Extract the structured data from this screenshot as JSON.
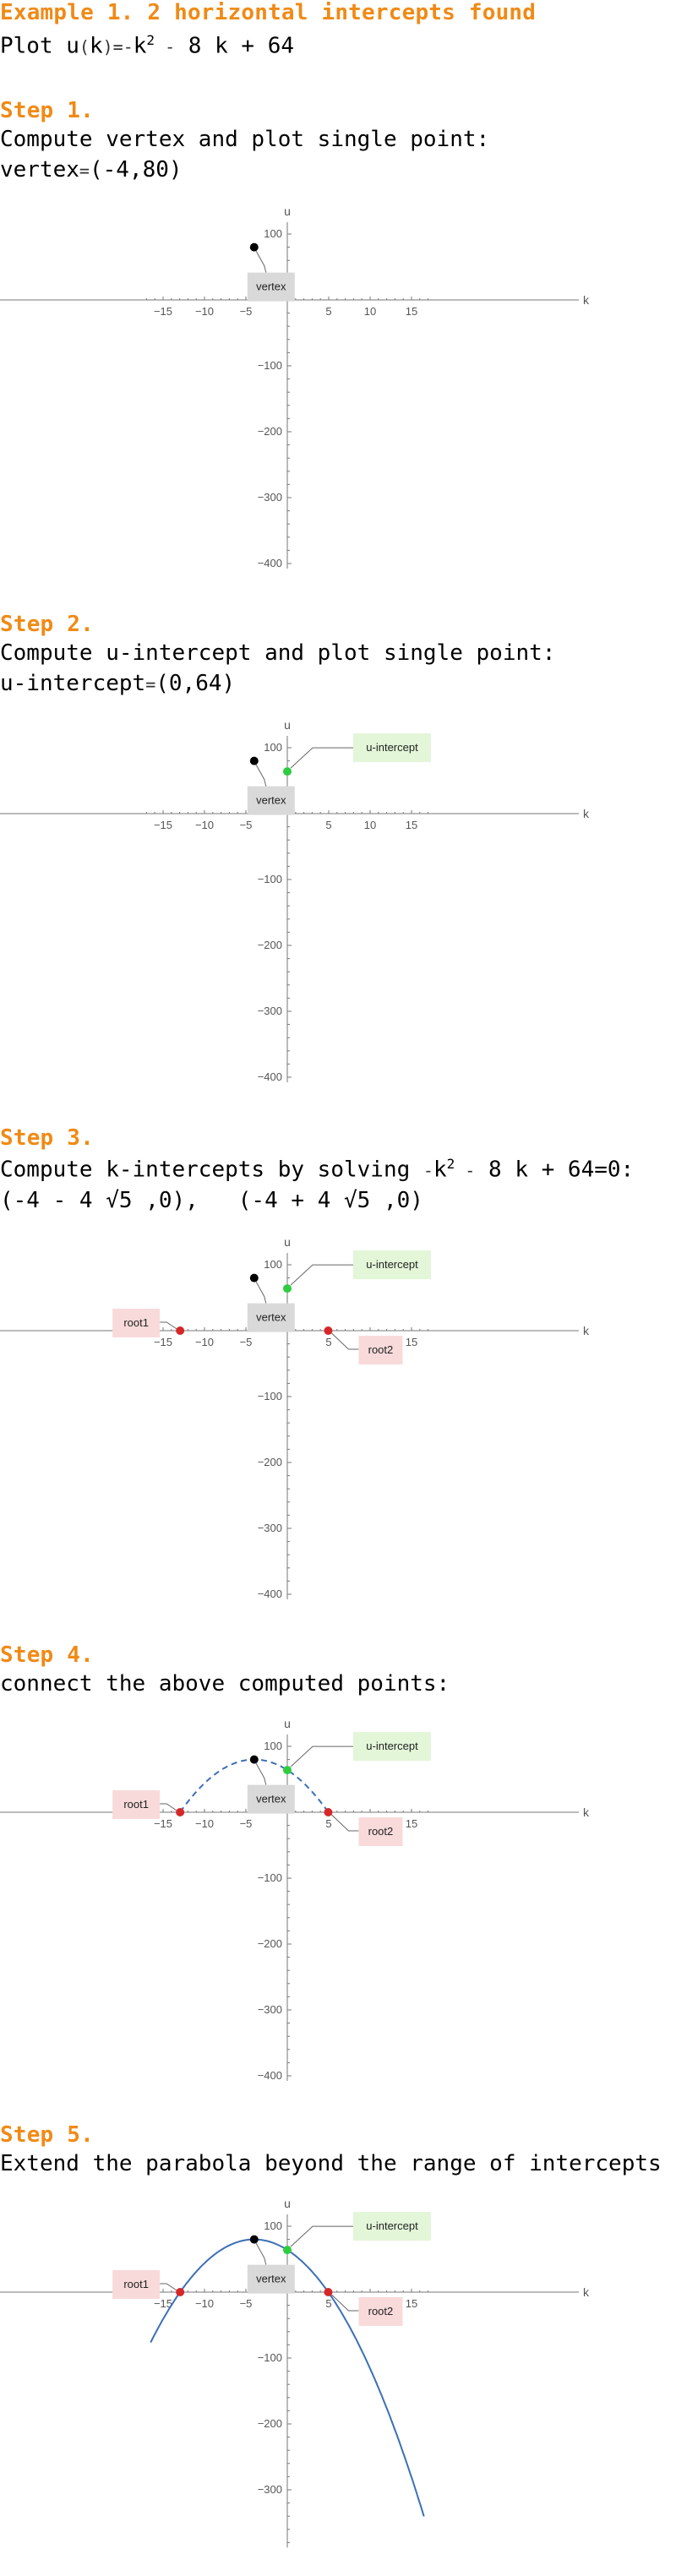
{
  "header": {
    "title": "Example 1. 2 horizontal intercepts found",
    "plot_prefix": "Plot u",
    "plot_rest": " 8 k + 64"
  },
  "steps": [
    {
      "title": "Step 1.",
      "line1": "Compute vertex and plot single point:",
      "line2_prefix": "vertex",
      "line2_value": "(-4,80)"
    },
    {
      "title": "Step 2.",
      "line1": "Compute u-intercept and plot single point:",
      "line2_prefix": "u-intercept",
      "line2_value": "(0,64)"
    },
    {
      "title": "Step 3.",
      "line1_prefix": "Compute k-intercepts by solving",
      "line1_rest": " 8 k + 64=0:",
      "root1": "(-4 - 4 √5 ,0)",
      "root2": "(-4 + 4 √5 ,0)"
    },
    {
      "title": "Step 4.",
      "line1": "connect the above computed points:"
    },
    {
      "title": "Step 5.",
      "line1": "Extend the parabola beyond the range of intercepts"
    }
  ],
  "labels": {
    "vertex": "vertex",
    "u_intercept": "u-intercept",
    "root1": "root1",
    "root2": "root2"
  },
  "colors": {
    "title": "#f08a16",
    "curve": "#3c6fb6",
    "vertex_point": "#000000",
    "u_intercept_point": "#2ecc40",
    "root_point": "#d62728",
    "vertex_label_bg": "#d9d9d9",
    "u_intercept_label_bg": "#e3f6d8",
    "root_label_bg": "#f8dada"
  },
  "chart_data": [
    {
      "type": "scatter",
      "xlabel": "k",
      "ylabel": "u",
      "xlim": [
        -17,
        17
      ],
      "ylim": [
        -400,
        100
      ],
      "xticks": [
        -15,
        -10,
        -5,
        5,
        10,
        15
      ],
      "yticks": [
        100,
        -100,
        -200,
        -300,
        -400
      ],
      "points": [
        {
          "name": "vertex",
          "x": -4,
          "y": 80
        }
      ],
      "curve": "none"
    },
    {
      "type": "scatter",
      "xlabel": "k",
      "ylabel": "u",
      "xlim": [
        -17,
        17
      ],
      "ylim": [
        -400,
        100
      ],
      "xticks": [
        -15,
        -10,
        -5,
        5,
        10,
        15
      ],
      "yticks": [
        100,
        -100,
        -200,
        -300,
        -400
      ],
      "points": [
        {
          "name": "vertex",
          "x": -4,
          "y": 80
        },
        {
          "name": "u-intercept",
          "x": 0,
          "y": 64
        }
      ],
      "curve": "none"
    },
    {
      "type": "scatter",
      "xlabel": "k",
      "ylabel": "u",
      "xlim": [
        -17,
        17
      ],
      "ylim": [
        -400,
        100
      ],
      "xticks": [
        -15,
        -10,
        -5,
        5,
        10,
        15
      ],
      "yticks": [
        100,
        -100,
        -200,
        -300,
        -400
      ],
      "points": [
        {
          "name": "vertex",
          "x": -4,
          "y": 80
        },
        {
          "name": "u-intercept",
          "x": 0,
          "y": 64
        },
        {
          "name": "root1",
          "x": -12.944,
          "y": 0
        },
        {
          "name": "root2",
          "x": 4.944,
          "y": 0
        }
      ],
      "curve": "none"
    },
    {
      "type": "line",
      "xlabel": "k",
      "ylabel": "u",
      "xlim": [
        -17,
        17
      ],
      "ylim": [
        -400,
        100
      ],
      "xticks": [
        -15,
        -10,
        -5,
        5,
        10,
        15
      ],
      "yticks": [
        100,
        -100,
        -200,
        -300,
        -400
      ],
      "points": [
        {
          "name": "vertex",
          "x": -4,
          "y": 80
        },
        {
          "name": "u-intercept",
          "x": 0,
          "y": 64
        },
        {
          "name": "root1",
          "x": -12.944,
          "y": 0
        },
        {
          "name": "root2",
          "x": 4.944,
          "y": 0
        }
      ],
      "curve": "dashed",
      "curve_range": [
        -12.944,
        4.944
      ]
    },
    {
      "type": "line",
      "xlabel": "k",
      "ylabel": "u",
      "xlim": [
        -17,
        17
      ],
      "ylim": [
        -380,
        100
      ],
      "xticks": [
        -15,
        -10,
        -5,
        5,
        10,
        15
      ],
      "yticks": [
        100,
        -100,
        -200,
        -300
      ],
      "points": [
        {
          "name": "vertex",
          "x": -4,
          "y": 80
        },
        {
          "name": "u-intercept",
          "x": 0,
          "y": 64
        },
        {
          "name": "root1",
          "x": -12.944,
          "y": 0
        },
        {
          "name": "root2",
          "x": 4.944,
          "y": 0
        }
      ],
      "curve": "solid",
      "curve_range": [
        -16.5,
        16.5
      ]
    }
  ]
}
